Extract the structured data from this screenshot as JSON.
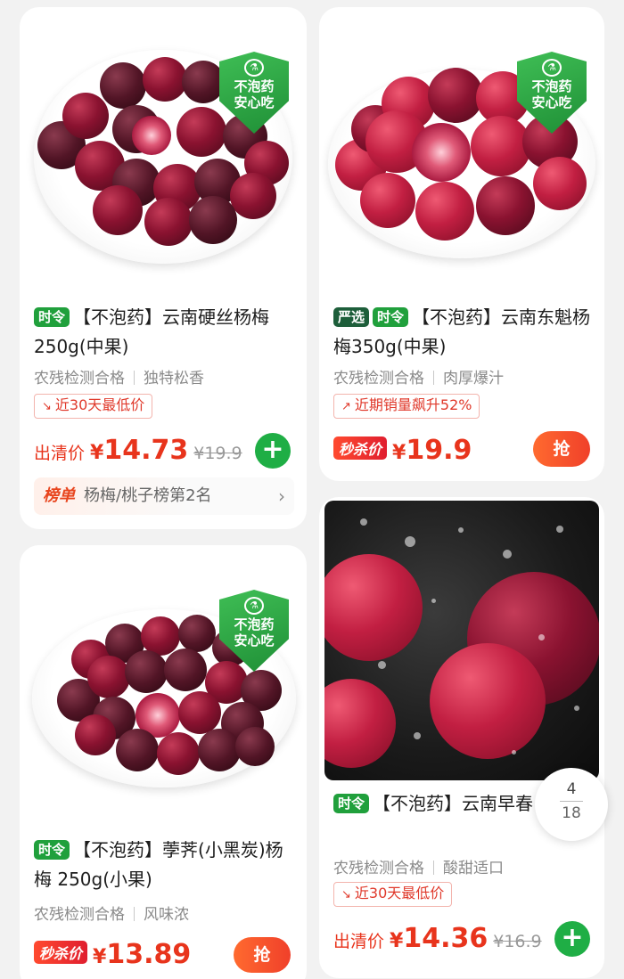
{
  "products": [
    {
      "tags": [
        "时令"
      ],
      "title": "【不泡药】云南硬丝杨梅250g(中果)",
      "badge": [
        "不泡药",
        "安心吃"
      ],
      "attr1": "农残检测合格",
      "attr2": "独特松香",
      "highlight": "近30天最低价",
      "highlight_icon": "trend-down-icon",
      "price_label": "出清价",
      "currency": "¥",
      "price": "14.73",
      "old_price": "19.9",
      "action": "add",
      "rank_label": "榜单",
      "rank_text": "杨梅/桃子榜第2名"
    },
    {
      "tags": [
        "严选",
        "时令"
      ],
      "title": "【不泡药】云南东魁杨梅350g(中果)",
      "badge": [
        "不泡药",
        "安心吃"
      ],
      "attr1": "农残检测合格",
      "attr2": "肉厚爆汁",
      "highlight": "近期销量飙升52%",
      "highlight_icon": "trend-up-icon",
      "price_label": "秒杀价",
      "currency": "¥",
      "price": "19.9",
      "action_label": "抢"
    },
    {
      "tags": [
        "时令"
      ],
      "title": "【不泡药】荸荠(小黑炭)杨梅 250g(小果)",
      "badge": [
        "不泡药",
        "安心吃"
      ],
      "attr1": "农残检测合格",
      "attr2": "风味浓",
      "price_label": "秒杀价",
      "currency": "¥",
      "price": "13.89",
      "action_label": "抢"
    },
    {
      "tags": [
        "时令"
      ],
      "title": "【不泡药】云南早春250g(小果)",
      "attr1": "农残检测合格",
      "attr2": "酸甜适口",
      "highlight": "近30天最低价",
      "highlight_icon": "trend-down-icon",
      "price_label": "出清价",
      "currency": "¥",
      "price": "14.36",
      "old_price": "16.9",
      "action": "add"
    }
  ],
  "pager": {
    "current": "4",
    "total": "18"
  },
  "colors": {
    "price": "#e8341c",
    "tag_green": "#20a03c",
    "add_button": "#1fae45"
  }
}
